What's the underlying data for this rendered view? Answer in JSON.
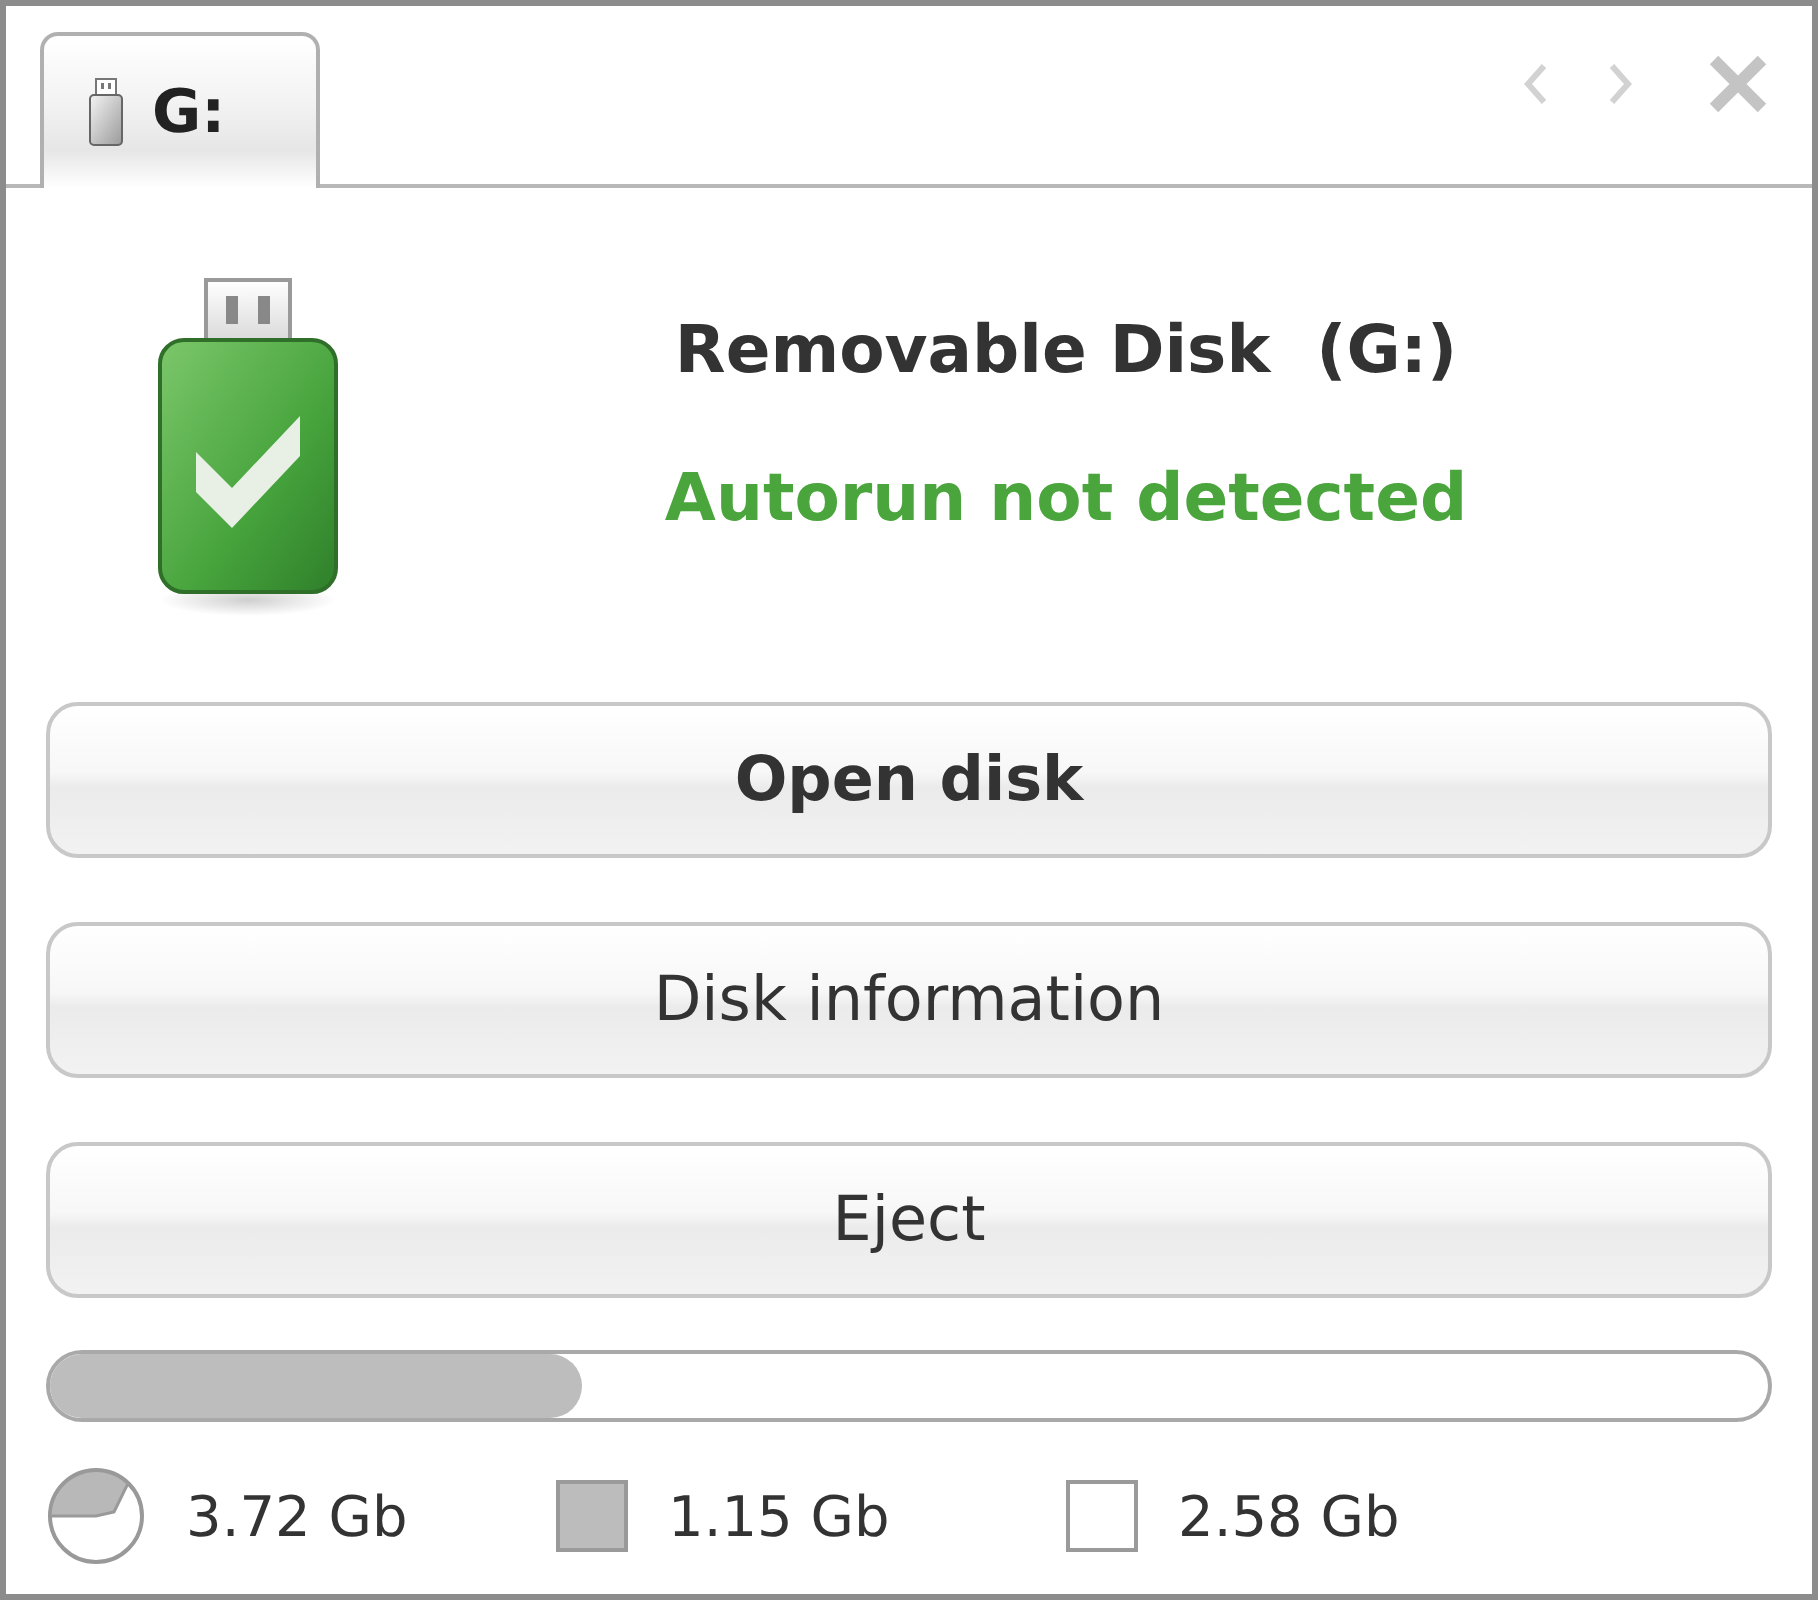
{
  "tab": {
    "label": "G:",
    "selected": true
  },
  "drive": {
    "name": "Removable Disk  (G:)",
    "status": "Autorun not detected"
  },
  "buttons": [
    {
      "label": "Open disk",
      "primary": true
    },
    {
      "label": "Disk information",
      "primary": false
    },
    {
      "label": "Eject",
      "primary": false
    }
  ],
  "usage": {
    "level": 0.31
  },
  "legend": [
    {
      "kind": "total",
      "text": "3.72 Gb"
    },
    {
      "kind": "used",
      "text": "1.15 Gb"
    },
    {
      "kind": "free",
      "text": "2.58 Gb"
    }
  ]
}
